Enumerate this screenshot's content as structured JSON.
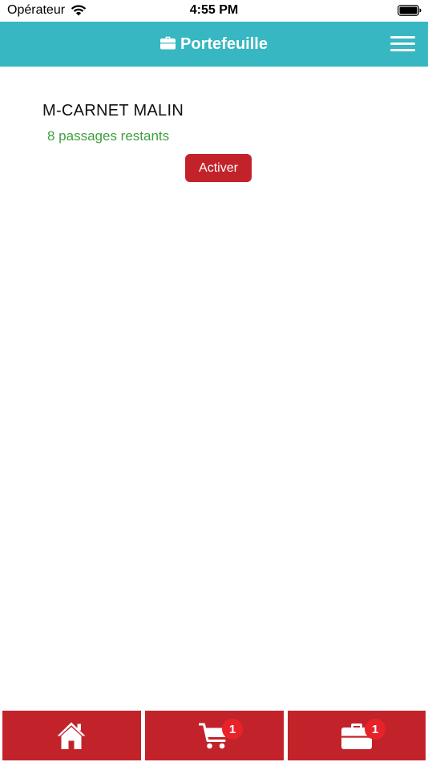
{
  "status_bar": {
    "carrier": "Opérateur",
    "time": "4:55 PM",
    "icons": [
      "wifi-icon",
      "battery-icon"
    ]
  },
  "header": {
    "title": "Portefeuille",
    "title_icon": "briefcase-icon",
    "menu_icon": "hamburger-menu-icon",
    "background_color": "#36b7c2"
  },
  "pass": {
    "name": "M-CARNET MALIN",
    "remaining": "8 passages restants",
    "activate_label": "Activer"
  },
  "bottom_nav": {
    "background_color": "#c2232b",
    "tabs": [
      {
        "icon": "home-icon"
      },
      {
        "icon": "cart-icon",
        "badge": "1"
      },
      {
        "icon": "briefcase-icon",
        "badge": "1"
      }
    ]
  }
}
